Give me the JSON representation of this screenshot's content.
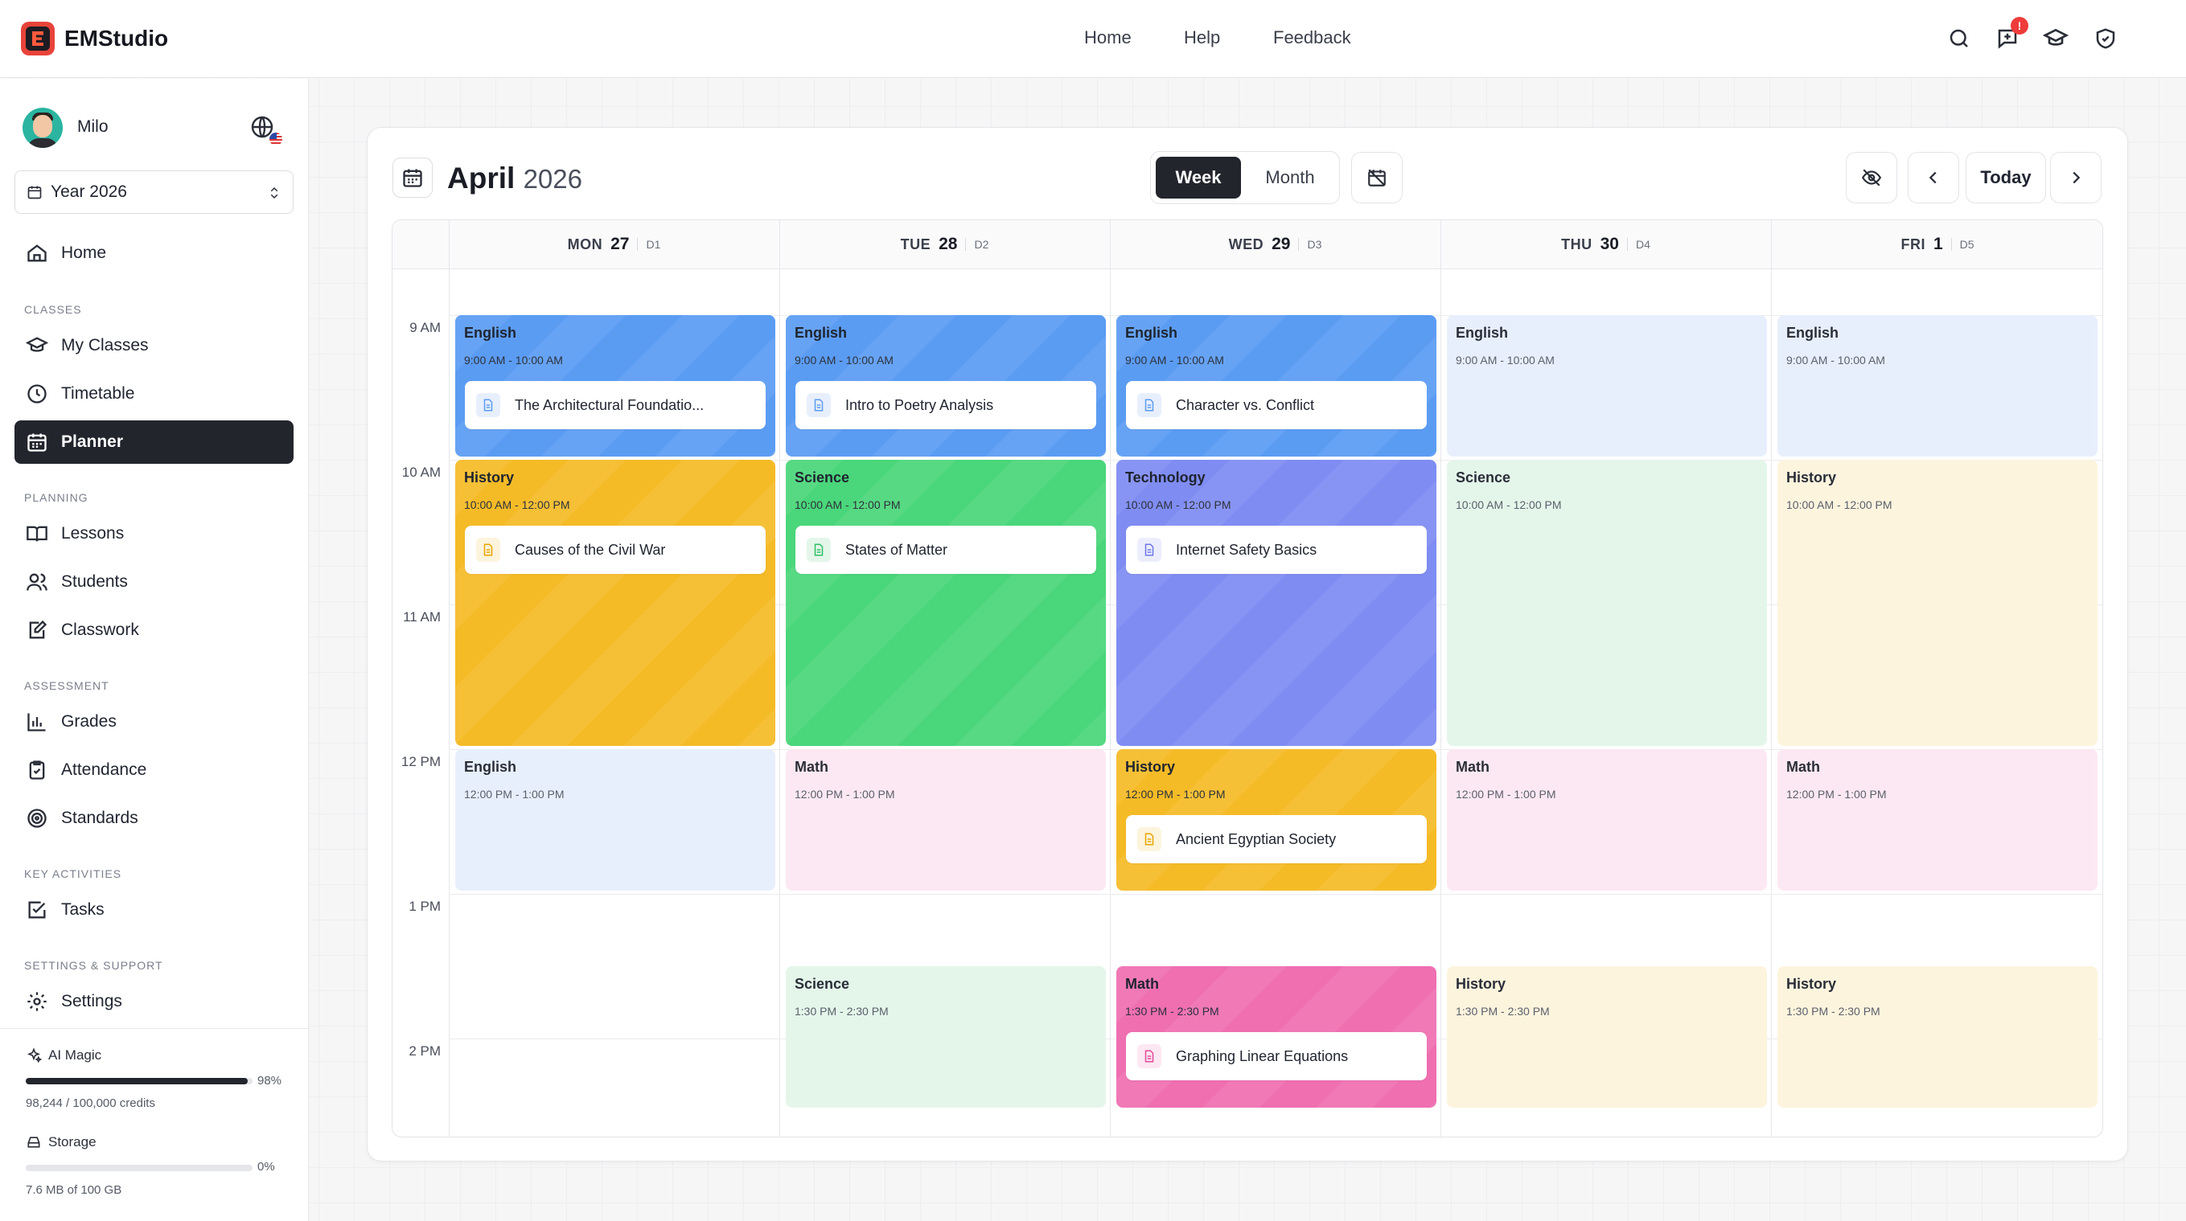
{
  "app": {
    "brand": "EMStudio"
  },
  "topnav": {
    "home": "Home",
    "help": "Help",
    "feedback": "Feedback",
    "notification_badge": "!"
  },
  "user": {
    "name": "Milo"
  },
  "sidebar": {
    "year_select": "Year 2026",
    "home": "Home",
    "sections": {
      "classes": "CLASSES",
      "planning": "PLANNING",
      "assessment": "ASSESSMENT",
      "key_activities": "KEY ACTIVITIES",
      "settings_support": "SETTINGS & SUPPORT"
    },
    "items": {
      "my_classes": "My Classes",
      "timetable": "Timetable",
      "planner": "Planner",
      "lessons": "Lessons",
      "students": "Students",
      "classwork": "Classwork",
      "grades": "Grades",
      "attendance": "Attendance",
      "standards": "Standards",
      "tasks": "Tasks",
      "settings": "Settings"
    },
    "ai_magic": {
      "label": "AI Magic",
      "percent_text": "98%",
      "fraction": 0.98,
      "credits": "98,244 / 100,000 credits"
    },
    "storage": {
      "label": "Storage",
      "percent_text": "0%",
      "fraction": 0.0,
      "usage": "7.6 MB of 100 GB"
    }
  },
  "calendar": {
    "month": "April",
    "year": "2026",
    "views": {
      "week": "Week",
      "month": "Month"
    },
    "today_label": "Today",
    "days": [
      {
        "name": "MON",
        "date": "27",
        "code": "D1"
      },
      {
        "name": "TUE",
        "date": "28",
        "code": "D2"
      },
      {
        "name": "WED",
        "date": "29",
        "code": "D3"
      },
      {
        "name": "THU",
        "date": "30",
        "code": "D4"
      },
      {
        "name": "FRI",
        "date": "1",
        "code": "D5"
      }
    ],
    "hours": [
      "9 AM",
      "10 AM",
      "11 AM",
      "12 PM",
      "1 PM",
      "2 PM"
    ],
    "colors": {
      "english_solid": "#5b9cf3",
      "english_light": "#e8effc",
      "history_solid": "#f5bb27",
      "history_light": "#fdf4de",
      "science_solid": "#4ad67a",
      "science_light": "#e4f6ea",
      "technology_solid": "#7f8cf2",
      "math_solid": "#ef6fb1",
      "math_light": "#fce8f2"
    },
    "events": {
      "mon_1": {
        "subject": "English",
        "time": "9:00 AM - 10:00 AM",
        "lesson": "The Architectural Foundatio..."
      },
      "mon_2": {
        "subject": "History",
        "time": "10:00 AM - 12:00 PM",
        "lesson": "Causes of the Civil War"
      },
      "mon_3": {
        "subject": "English",
        "time": "12:00 PM - 1:00 PM"
      },
      "tue_1": {
        "subject": "English",
        "time": "9:00 AM - 10:00 AM",
        "lesson": "Intro to Poetry Analysis"
      },
      "tue_2": {
        "subject": "Science",
        "time": "10:00 AM - 12:00 PM",
        "lesson": "States of Matter"
      },
      "tue_3": {
        "subject": "Math",
        "time": "12:00 PM - 1:00 PM"
      },
      "tue_4": {
        "subject": "Science",
        "time": "1:30 PM - 2:30 PM"
      },
      "wed_1": {
        "subject": "English",
        "time": "9:00 AM - 10:00 AM",
        "lesson": "Character vs. Conflict"
      },
      "wed_2": {
        "subject": "Technology",
        "time": "10:00 AM - 12:00 PM",
        "lesson": "Internet Safety Basics"
      },
      "wed_3": {
        "subject": "History",
        "time": "12:00 PM - 1:00 PM",
        "lesson": "Ancient Egyptian Society"
      },
      "wed_4": {
        "subject": "Math",
        "time": "1:30 PM - 2:30 PM",
        "lesson": "Graphing Linear Equations"
      },
      "thu_1": {
        "subject": "English",
        "time": "9:00 AM - 10:00 AM"
      },
      "thu_2": {
        "subject": "Science",
        "time": "10:00 AM - 12:00 PM"
      },
      "thu_3": {
        "subject": "Math",
        "time": "12:00 PM - 1:00 PM"
      },
      "thu_4": {
        "subject": "History",
        "time": "1:30 PM - 2:30 PM"
      },
      "fri_1": {
        "subject": "English",
        "time": "9:00 AM - 10:00 AM"
      },
      "fri_2": {
        "subject": "History",
        "time": "10:00 AM - 12:00 PM"
      },
      "fri_3": {
        "subject": "Math",
        "time": "12:00 PM - 1:00 PM"
      },
      "fri_4": {
        "subject": "History",
        "time": "1:30 PM - 2:30 PM"
      }
    }
  }
}
